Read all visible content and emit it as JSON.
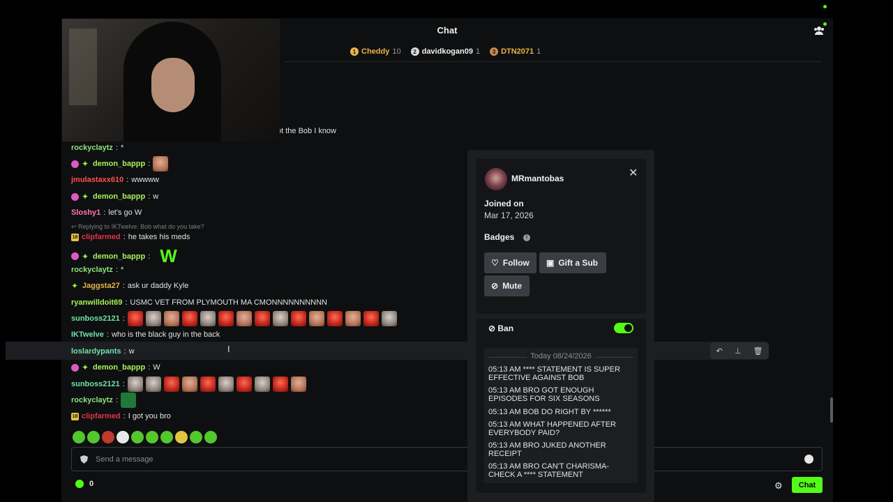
{
  "header": {
    "title": "Chat"
  },
  "leaderboard": [
    {
      "rank": "1",
      "name": "Cheddy",
      "count": "10",
      "color": "#e8b44a",
      "rank_color": "#e8b44a"
    },
    {
      "rank": "2",
      "name": "davidkogan09",
      "count": "1",
      "color": "#f0f0f0",
      "rank_color": "#d8d8d8"
    },
    {
      "rank": "3",
      "name": "DTN2071",
      "count": "1",
      "color": "#e8b44a",
      "rank_color": "#c98a4a"
    }
  ],
  "partial_message": "ot the Bob I know",
  "messages": [
    {
      "user": "rockyclaytz",
      "text": "*"
    },
    {
      "user": "demon_bappp"
    },
    {
      "user": "jmulastaxx610",
      "text": "wwwww"
    },
    {
      "user": "demon_bappp",
      "text": "w"
    },
    {
      "user": "Sloshy1",
      "text": "let's go W"
    },
    {
      "reply": "Replying to IKTwelve: Bob what do you take?"
    },
    {
      "user": "clipfarmed",
      "text": "he takes his meds"
    },
    {
      "user": "demon_bappp",
      "text": "W"
    },
    {
      "user": "rockyclaytz",
      "text": "*"
    },
    {
      "user": "Jaggsta27",
      "text": "ask ur daddy Kyle"
    },
    {
      "user": "ryanwilldoit69",
      "text": "USMC VET FROM PLYMOUTH MA CMONNNNNNNNNN"
    },
    {
      "user": "sunboss2121"
    },
    {
      "user": "IKTwelve",
      "text": "who is the black guy in the back"
    },
    {
      "user": "loslardypants",
      "text": "w"
    },
    {
      "user": "demon_bappp",
      "text": "W"
    },
    {
      "user": "sunboss2121"
    },
    {
      "user": "rockyclaytz"
    },
    {
      "user": "clipfarmed",
      "text": "I got you bro"
    }
  ],
  "input": {
    "placeholder": "Send a message"
  },
  "footer": {
    "points": "0",
    "send_label": "Chat"
  },
  "user_card": {
    "username": "MRmantobas",
    "joined_label": "Joined on",
    "joined_date": "Mar 17, 2026",
    "badges_label": "Badges",
    "follow_label": "Follow",
    "gift_label": "Gift a Sub",
    "mute_label": "Mute",
    "ban_label": "Ban",
    "log_date": "Today 08/24/2026",
    "log": [
      "05:13 AM **** STATEMENT IS SUPER EFFECTIVE AGAINST BOB",
      "05:13 AM BRO GOT ENOUGH EPISODES FOR SIX SEASONS",
      "05:13 AM BOB DO RIGHT BY ******",
      "05:13 AM WHAT HAPPENED AFTER EVERYBODY PAID?",
      "05:13 AM BRO JUKED ANOTHER RECEIPT",
      "05:13 AM BRO CAN'T CHARISMA-CHECK A **** STATEMENT"
    ]
  },
  "colors": {
    "accent": "#53fc18",
    "background": "#0e0f10",
    "card": "#1c1e21"
  }
}
